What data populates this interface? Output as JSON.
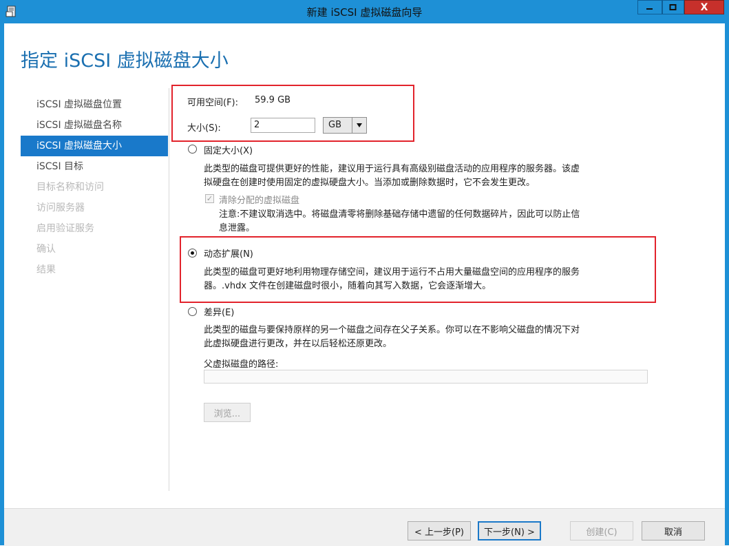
{
  "window": {
    "title": "新建 iSCSI 虚拟磁盘向导",
    "close_glyph": "X"
  },
  "page": {
    "title": "指定 iSCSI 虚拟磁盘大小"
  },
  "nav": {
    "items": [
      {
        "label": "iSCSI 虚拟磁盘位置",
        "state": "normal"
      },
      {
        "label": "iSCSI 虚拟磁盘名称",
        "state": "normal"
      },
      {
        "label": "iSCSI 虚拟磁盘大小",
        "state": "active"
      },
      {
        "label": "iSCSI 目标",
        "state": "normal"
      },
      {
        "label": "目标名称和访问",
        "state": "disabled"
      },
      {
        "label": "访问服务器",
        "state": "disabled"
      },
      {
        "label": "启用验证服务",
        "state": "disabled"
      },
      {
        "label": "确认",
        "state": "disabled"
      },
      {
        "label": "结果",
        "state": "disabled"
      }
    ]
  },
  "size": {
    "available_label": "可用空间(F):",
    "available_value": "59.9 GB",
    "size_label": "大小(S):",
    "size_value": "2",
    "unit": "GB"
  },
  "options": {
    "fixed": {
      "label": "固定大小(X)",
      "checked": false,
      "desc_line1": "此类型的磁盘可提供更好的性能，建议用于运行具有高级别磁盘活动的应用程序的服务器。该虚",
      "desc_line2": "拟硬盘在创建时使用固定的虚拟硬盘大小。当添加或删除数据时，它不会发生更改。",
      "clear_label": "清除分配的虚拟磁盘",
      "clear_checked": true,
      "note_line1": "注意:不建议取消选中。将磁盘清零将删除基础存储中遗留的任何数据碎片，因此可以防止信",
      "note_line2": "息泄露。"
    },
    "dynamic": {
      "label": "动态扩展(N)",
      "checked": true,
      "desc_line1": "此类型的磁盘可更好地利用物理存储空间，建议用于运行不占用大量磁盘空间的应用程序的服务",
      "desc_line2": "器。.vhdx 文件在创建磁盘时很小，随着向其写入数据，它会逐渐增大。"
    },
    "differencing": {
      "label": "差异(E)",
      "checked": false,
      "desc_line1": "此类型的磁盘与要保持原样的另一个磁盘之间存在父子关系。你可以在不影响父磁盘的情况下对",
      "desc_line2": "此虚拟硬盘进行更改，并在以后轻松还原更改。",
      "parent_path_label": "父虚拟磁盘的路径:",
      "parent_path_value": "",
      "browse_label": "浏览..."
    }
  },
  "footer": {
    "prev_label": "< 上一步(P)",
    "next_label": "下一步(N) >",
    "create_label": "创建(C)",
    "cancel_label": "取消"
  },
  "colors": {
    "titlebar": "#1e90d6",
    "accent": "#1979ca",
    "highlight_box": "#e2222b",
    "close_button": "#c7302b"
  }
}
